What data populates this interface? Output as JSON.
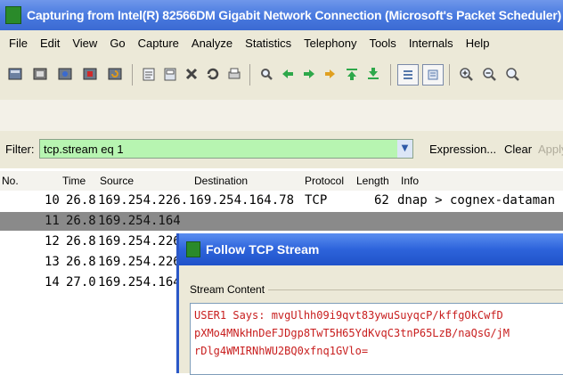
{
  "window": {
    "title": "Capturing from Intel(R) 82566DM Gigabit Network Connection (Microsoft's Packet Scheduler)"
  },
  "menu": [
    "File",
    "Edit",
    "View",
    "Go",
    "Capture",
    "Analyze",
    "Statistics",
    "Telephony",
    "Tools",
    "Internals",
    "Help"
  ],
  "toolbar": {
    "icons": [
      "interface-list-icon",
      "capture-options-icon",
      "start-capture-icon",
      "stop-capture-icon",
      "restart-capture-icon",
      "open-file-icon",
      "save-file-icon",
      "close-file-icon",
      "reload-icon",
      "print-icon",
      "find-packet-icon",
      "go-back-icon",
      "go-forward-icon",
      "go-to-packet-icon",
      "go-first-icon",
      "go-last-icon",
      "colorize-icon",
      "auto-scroll-icon",
      "zoom-in-icon",
      "zoom-out-icon",
      "zoom-normal-icon"
    ]
  },
  "filter": {
    "label": "Filter:",
    "value": "tcp.stream eq 1",
    "expression_label": "Expression...",
    "clear_label": "Clear",
    "apply_label": "Apply"
  },
  "packet_list": {
    "columns": [
      "No.",
      "Time",
      "Source",
      "Destination",
      "Protocol",
      "Length",
      "Info"
    ],
    "rows": [
      {
        "no": "10",
        "time": "26.8",
        "source": "169.254.226.",
        "destination": "169.254.164.78",
        "protocol": "TCP",
        "length": "62",
        "info": "dnap > cognex-dataman"
      },
      {
        "no": "11",
        "time": "26.8",
        "source": "169.254.164",
        "destination": "",
        "protocol": "",
        "length": "",
        "info": ""
      },
      {
        "no": "12",
        "time": "26.8",
        "source": "169.254.226",
        "destination": "",
        "protocol": "",
        "length": "",
        "info": ""
      },
      {
        "no": "13",
        "time": "26.8",
        "source": "169.254.226",
        "destination": "",
        "protocol": "",
        "length": "",
        "info": ""
      },
      {
        "no": "14",
        "time": "27.0",
        "source": "169.254.164",
        "destination": "",
        "protocol": "",
        "length": "",
        "info": ""
      }
    ],
    "selected_row": 1
  },
  "dialog": {
    "title": "Follow TCP Stream",
    "group_label": "Stream Content",
    "lines": [
      "USER1 Says:  mvgUlhh09i9qvt83ywuSuyqcP/kffgOkCwfD",
      "pXMo4MNkHnDeFJDgp8TwT5H65YdKvqC3tnP65LzB/naQsG/jM",
      "rDlg4WMIRNhWU2BQ0xfnq1GVlo="
    ]
  }
}
